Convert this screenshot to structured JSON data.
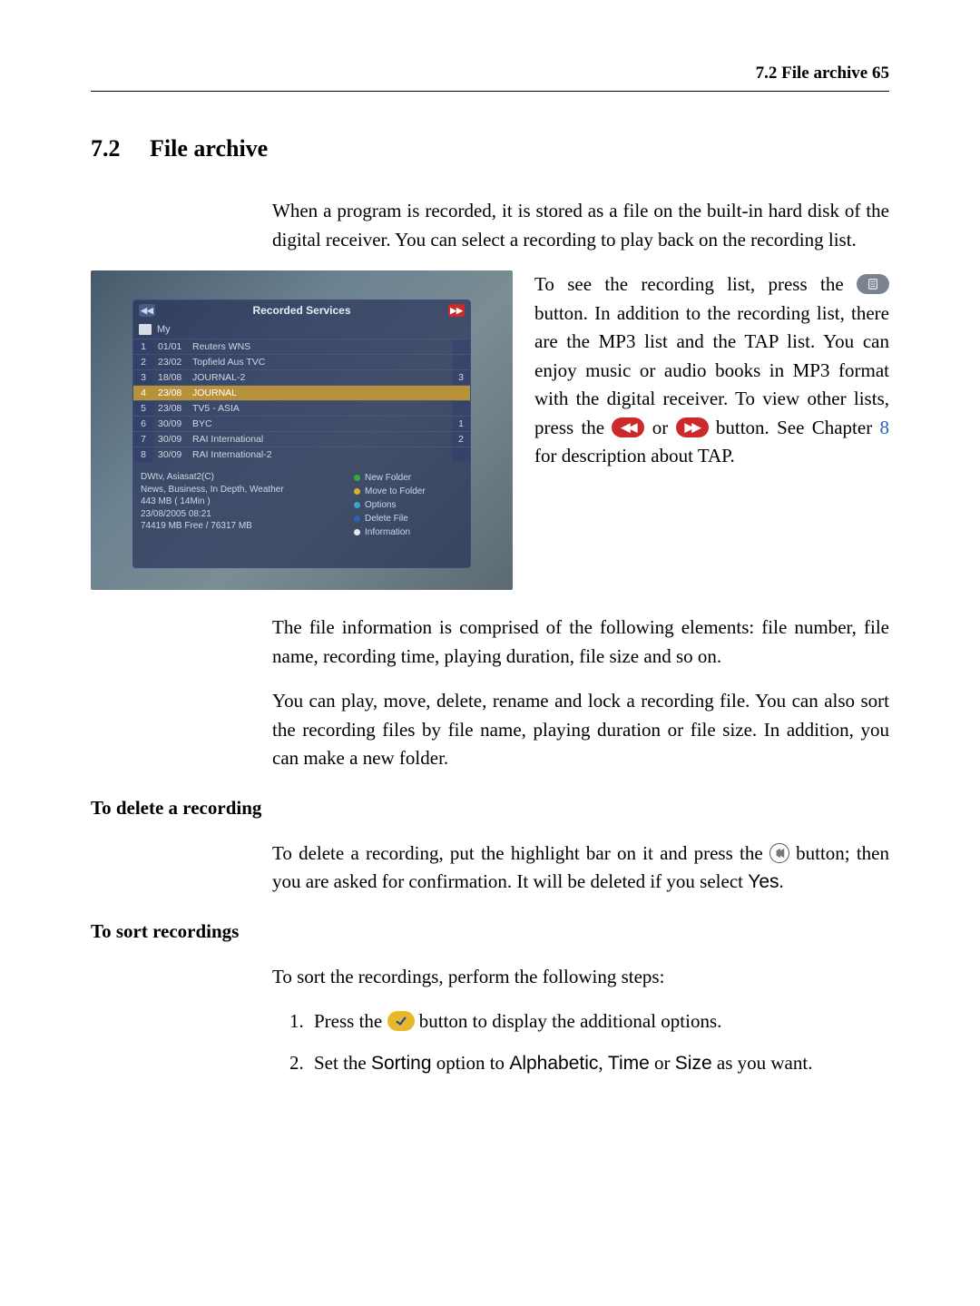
{
  "page_header": "7.2 File archive    65",
  "section": {
    "number": "7.2",
    "title": "File archive"
  },
  "para_intro": "When a program is recorded, it is stored as a file on the built-in hard disk of the digital receiver. You can select a recording to play back on the recording list.",
  "screenshot": {
    "title": "Recorded Services",
    "folder_label": "My",
    "rows": [
      {
        "idx": "1",
        "date": "01/01",
        "name": "Reuters WNS",
        "mark": ""
      },
      {
        "idx": "2",
        "date": "23/02",
        "name": "Topfield Aus TVC",
        "mark": ""
      },
      {
        "idx": "3",
        "date": "18/08",
        "name": "JOURNAL-2",
        "mark": "3"
      },
      {
        "idx": "4",
        "date": "23/08",
        "name": "JOURNAL",
        "mark": "",
        "selected": true
      },
      {
        "idx": "5",
        "date": "23/08",
        "name": "TV5 - ASIA",
        "mark": ""
      },
      {
        "idx": "6",
        "date": "30/09",
        "name": "BYC",
        "mark": "1"
      },
      {
        "idx": "7",
        "date": "30/09",
        "name": "RAI International",
        "mark": "2"
      },
      {
        "idx": "8",
        "date": "30/09",
        "name": "RAI International-2",
        "mark": ""
      }
    ],
    "info": {
      "l1": "DWtv, Asiasat2(C)",
      "l2": "News, Business, In Depth, Weather",
      "l3": "443 MB  ( 14Min )",
      "l4": "23/08/2005 08:21",
      "l5": "74419 MB Free / 76317 MB"
    },
    "legend": {
      "a": "New Folder",
      "b": "Move to Folder",
      "c": "Options",
      "d": "Delete File",
      "e": "Information"
    }
  },
  "right_col": {
    "t1": "To see the recording list, press the ",
    "t2": " button.    In addition to the recording list, there are the MP3 list and the TAP list. You can enjoy music or audio books in MP3 format with the digital receiver.  To view other lists, press the ",
    "t3": " or ",
    "t4": " button.  See Chapter ",
    "chapter": "8",
    "t5": " for description about TAP."
  },
  "para_fileinfo": "The file information is comprised of the following elements: file number, file name, recording time, playing duration, file size and so on.",
  "para_actions": "You can play, move, delete, rename and lock a recording file. You can also sort the recording files by file name, playing duration or file size. In addition, you can make a new folder.",
  "h_delete": "To delete a recording",
  "para_delete": {
    "t1": "To delete a recording, put the highlight bar on it and press the ",
    "t2": " button; then you are asked for confirmation. It will be deleted if you select ",
    "yes": "Yes",
    "t3": "."
  },
  "h_sort": "To sort recordings",
  "para_sort_intro": "To sort the recordings, perform the following steps:",
  "steps": {
    "s1a": "Press the ",
    "s1b": " button to display the additional options.",
    "s2a": "Set the ",
    "s2_sorting": "Sorting",
    "s2b": " option to ",
    "s2_alpha": "Alphabetic",
    "s2c": ", ",
    "s2_time": "Time",
    "s2d": " or ",
    "s2_size": "Size",
    "s2e": " as you want."
  }
}
